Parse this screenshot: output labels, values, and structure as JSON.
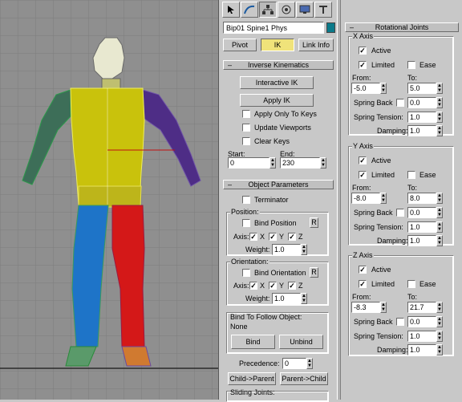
{
  "toolbar": {
    "tools": [
      "cursor-icon",
      "curve-icon",
      "hierarchy-icon",
      "motion-icon",
      "display-icon",
      "utilities-icon"
    ]
  },
  "object_name": "Bip01 Spine1 Phys",
  "color": "#0b7a8a",
  "tabs": {
    "pivot": "Pivot",
    "ik": "IK",
    "link_info": "Link Info"
  },
  "ik": {
    "title": "Inverse Kinematics",
    "interactive_ik": "Interactive IK",
    "apply_ik": "Apply IK",
    "apply_only_to_keys": "Apply Only To Keys",
    "update_viewports": "Update Viewports",
    "clear_keys": "Clear Keys",
    "start_label": "Start:",
    "end_label": "End:",
    "start": "0",
    "end": "230"
  },
  "object_params": {
    "title": "Object Parameters",
    "terminator": "Terminator",
    "position_label": "Position:",
    "bind_position": "Bind Position",
    "r": "R",
    "axis_label": "Axis:",
    "x": "X",
    "y": "Y",
    "z": "Z",
    "weight_label": "Weight:",
    "weight_pos": "1.0",
    "orientation_label": "Orientation:",
    "bind_orientation": "Bind Orientation",
    "weight_ori": "1.0",
    "bind_follow_label": "Bind To Follow Object:",
    "bind_follow_value": "None",
    "bind": "Bind",
    "unbind": "Unbind",
    "precedence_label": "Precedence:",
    "precedence": "0",
    "child_parent": "Child->Parent",
    "parent_child": "Parent->Child",
    "sliding_joints": "Sliding Joints:"
  },
  "rotational": {
    "title": "Rotational Joints",
    "active": "Active",
    "limited": "Limited",
    "ease": "Ease",
    "from": "From:",
    "to": "To:",
    "spring_back": "Spring Back",
    "spring_tension": "Spring Tension:",
    "damping": "Damping:",
    "axes": [
      {
        "name": "X Axis",
        "from": "-5.0",
        "to": "5.0",
        "spring_back": "0.0",
        "spring_tension": "1.0",
        "damping": "1.0"
      },
      {
        "name": "Y Axis",
        "from": "-8.0",
        "to": "8.0",
        "spring_back": "0.0",
        "spring_tension": "1.0",
        "damping": "1.0"
      },
      {
        "name": "Z Axis",
        "from": "-8.3",
        "to": "21.7",
        "spring_back": "0.0",
        "spring_tension": "1.0",
        "damping": "1.0"
      }
    ]
  }
}
